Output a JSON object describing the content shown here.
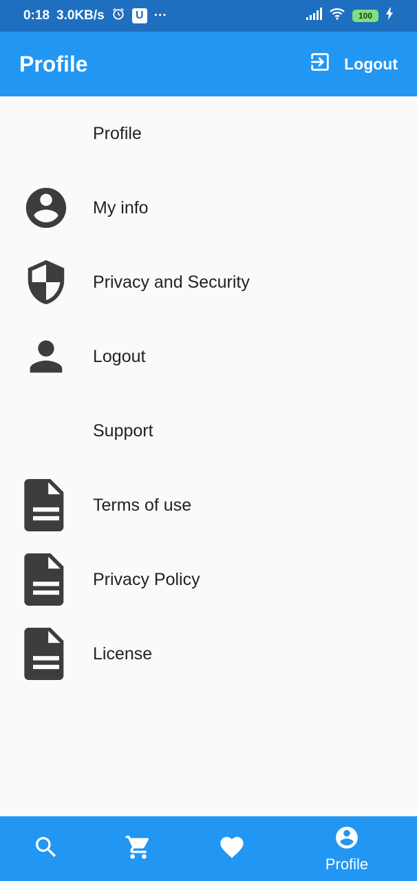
{
  "status_bar": {
    "time": "0:18",
    "speed": "3.0KB/s",
    "u_badge": "U",
    "more": "···",
    "battery": "100",
    "icons": [
      "alarm-icon",
      "signal-icon",
      "wifi-icon",
      "battery-icon",
      "charging-icon"
    ]
  },
  "app_bar": {
    "title": "Profile",
    "logout_label": "Logout",
    "logout_icon": "logout-icon"
  },
  "sections": {
    "profile_header": "Profile",
    "support_header": "Support"
  },
  "items": [
    {
      "label": "My info",
      "icon": "account-circle-icon"
    },
    {
      "label": "Privacy and Security",
      "icon": "shield-icon"
    },
    {
      "label": "Logout",
      "icon": "person-icon"
    },
    {
      "label": "Terms of use",
      "icon": "document-icon"
    },
    {
      "label": "Privacy Policy",
      "icon": "document-icon"
    },
    {
      "label": "License",
      "icon": "document-icon"
    }
  ],
  "bottom_nav": {
    "items": [
      {
        "name": "search",
        "icon": "search-icon"
      },
      {
        "name": "cart",
        "icon": "cart-icon"
      },
      {
        "name": "favorites",
        "icon": "heart-icon"
      },
      {
        "name": "profile",
        "icon": "account-circle-icon",
        "label": "Profile"
      }
    ]
  },
  "colors": {
    "primary": "#2196f3",
    "status_bar": "#1e6fbf",
    "icon": "#3d3d3d",
    "background": "#fafafa",
    "text": "#222222"
  }
}
